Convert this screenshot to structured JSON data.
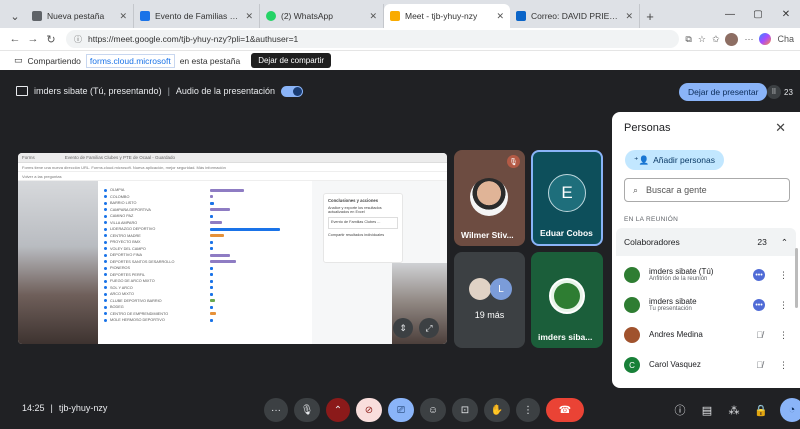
{
  "browser": {
    "tabs": [
      {
        "title": "Nueva pestaña",
        "fav_color": "#5f6368"
      },
      {
        "title": "Evento de Familias Clubes y F",
        "fav_color": "#1a73e8"
      },
      {
        "title": "(2) WhatsApp",
        "fav_color": "#25d366"
      },
      {
        "title": "Meet - tjb-yhuy-nzy",
        "fav_color": "#f9ab00"
      },
      {
        "title": "Correo: DAVID PRIETO - Outlook",
        "fav_color": "#0a64c8"
      }
    ],
    "new_tab": "+",
    "url": "https://meet.google.com/tjb-yhuy-nzy?pli=1&authuser=1",
    "profile_label": "Cha"
  },
  "share_banner": {
    "prefix": "Compartiendo",
    "domain": "forms.cloud.microsoft",
    "suffix": "en esta pestaña",
    "stop_label": "Dejar de compartir"
  },
  "meet": {
    "presenting_label": "imders sibate (Tú, presentando)",
    "audio_label": "Audio de la presentación",
    "stop_presenting": "Dejar de presentar",
    "participant_count": "23",
    "screen": {
      "app_title": "Forms",
      "doc_title": "Evento de Familias Clubes y PTE de Ocaal - Guardado",
      "info_line": "Forms tiene una nueva dirección URL. Forms.cloud.microsoft. Nueva aplicación, mejor seguridad. Más información",
      "back_label": "Volver a las preguntas",
      "rows": [
        {
          "label": "OLMPIA",
          "bar_color": "#8e7cc3",
          "bar_width": 34
        },
        {
          "label": "COLOMBO",
          "bar_color": "#8e7cc3",
          "bar_width": 3
        },
        {
          "label": "BARRIO LISTO",
          "bar_color": "#1a73e8",
          "bar_width": 4
        },
        {
          "label": "CAMPAÑA DEPORTIVA",
          "bar_color": "#8e7cc3",
          "bar_width": 20
        },
        {
          "label": "CAMINO PAZ",
          "bar_color": "#1a73e8",
          "bar_width": 3
        },
        {
          "label": "VILLA AMPARO",
          "bar_color": "#8e7cc3",
          "bar_width": 12
        },
        {
          "label": "LIDERAZGO DEPORTIVO",
          "bar_color": "#1a73e8",
          "bar_width": 70
        },
        {
          "label": "CENTRO MADRE",
          "bar_color": "#e69138",
          "bar_width": 14
        },
        {
          "label": "PROYECTO BMX",
          "bar_color": "#1a73e8",
          "bar_width": 3
        },
        {
          "label": "VOLEY DEL CAMPO",
          "bar_color": "#1a73e8",
          "bar_width": 3
        },
        {
          "label": "DEPORTIVO FINA",
          "bar_color": "#8e7cc3",
          "bar_width": 20
        },
        {
          "label": "DEPORTES SANTOS DESARROLLO",
          "bar_color": "#8e7cc3",
          "bar_width": 26
        },
        {
          "label": "PIONEROS",
          "bar_color": "#1a73e8",
          "bar_width": 3
        },
        {
          "label": "DEPORTES PERFIL",
          "bar_color": "#1a73e8",
          "bar_width": 3
        },
        {
          "label": "FUEGO DE ARCO MIXTO",
          "bar_color": "#1a73e8",
          "bar_width": 3
        },
        {
          "label": "SOL Y ARCO",
          "bar_color": "#1a73e8",
          "bar_width": 3
        },
        {
          "label": "ARCO MIXTO",
          "bar_color": "#1a73e8",
          "bar_width": 3
        },
        {
          "label": "CLUBE DEPORTIVO BARRIO",
          "bar_color": "#6aa84f",
          "bar_width": 5
        },
        {
          "label": "BODEG",
          "bar_color": "#1a73e8",
          "bar_width": 3
        },
        {
          "label": "CENTRO DE EMPRENDIMIENTO",
          "bar_color": "#e69138",
          "bar_width": 6
        },
        {
          "label": "MOLE HERMOSO DEPORTIVO",
          "bar_color": "#1a73e8",
          "bar_width": 3
        }
      ],
      "card_title": "Conclusiones y acciones",
      "card_text": "Analice y exporte los resultados actualizados en Excel",
      "card_item": "Evento de Familias Clubes ...",
      "card_link": "Compartir resultados individuales"
    },
    "tiles": {
      "wilmer": "Wilmer Stiv...",
      "eduar": "Eduar Cobos",
      "eduar_initial": "E",
      "more_initial": "L",
      "more": "19 más",
      "imders": "imders siba..."
    },
    "bottom": {
      "time": "14:25",
      "code": "tjb-yhuy-nzy"
    }
  },
  "people_panel": {
    "title": "Personas",
    "add_label": "Añadir personas",
    "search_placeholder": "Buscar a gente",
    "section": "EN LA REUNIÓN",
    "group_label": "Colaboradores",
    "group_count": "23",
    "people": [
      {
        "name": "imders sibate (Tú)",
        "sub": "Anfitrión de la reunión",
        "color": "#2e7d32",
        "initial": ""
      },
      {
        "name": "imders sibate",
        "sub": "Tu presentación",
        "color": "#2e7d32",
        "initial": ""
      },
      {
        "name": "Andres Medina",
        "sub": "",
        "color": "#a0522d",
        "initial": ""
      },
      {
        "name": "Carol Vasquez",
        "sub": "",
        "color": "#188038",
        "initial": "C"
      }
    ]
  }
}
